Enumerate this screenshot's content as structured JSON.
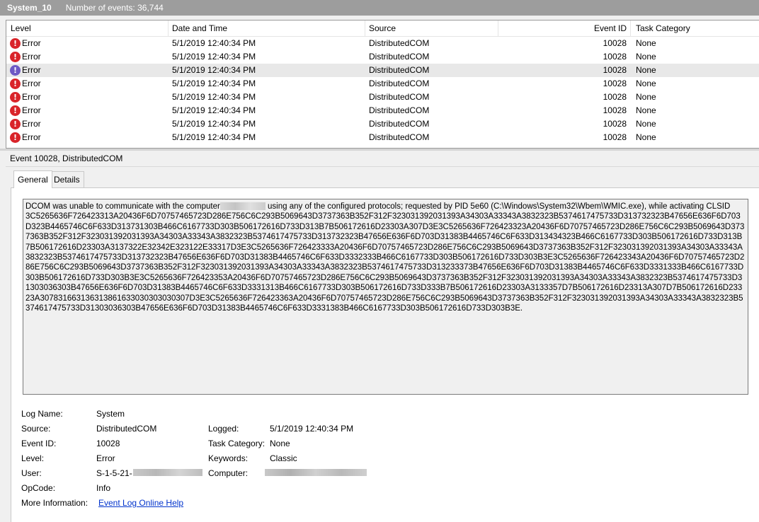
{
  "log": {
    "name": "System_10",
    "event_count": "Number of events: 36,744"
  },
  "grid": {
    "columns": [
      "Level",
      "Date and Time",
      "Source",
      "Event ID",
      "Task Category"
    ],
    "rows": [
      {
        "level": "Error",
        "date": "5/1/2019 12:40:34 PM",
        "source": "DistributedCOM",
        "id": "10028",
        "category": "None"
      },
      {
        "level": "Error",
        "date": "5/1/2019 12:40:34 PM",
        "source": "DistributedCOM",
        "id": "10028",
        "category": "None"
      },
      {
        "level": "Error",
        "date": "5/1/2019 12:40:34 PM",
        "source": "DistributedCOM",
        "id": "10028",
        "category": "None"
      },
      {
        "level": "Error",
        "date": "5/1/2019 12:40:34 PM",
        "source": "DistributedCOM",
        "id": "10028",
        "category": "None"
      },
      {
        "level": "Error",
        "date": "5/1/2019 12:40:34 PM",
        "source": "DistributedCOM",
        "id": "10028",
        "category": "None"
      },
      {
        "level": "Error",
        "date": "5/1/2019 12:40:34 PM",
        "source": "DistributedCOM",
        "id": "10028",
        "category": "None"
      },
      {
        "level": "Error",
        "date": "5/1/2019 12:40:34 PM",
        "source": "DistributedCOM",
        "id": "10028",
        "category": "None"
      },
      {
        "level": "Error",
        "date": "5/1/2019 12:40:34 PM",
        "source": "DistributedCOM",
        "id": "10028",
        "category": "None"
      }
    ],
    "icon": "error-icon"
  },
  "detail": {
    "title": "Event 10028, DistributedCOM",
    "tabs": {
      "general": "General",
      "details": "Details"
    },
    "message": {
      "part1": "DCOM was unable to communicate with the computer",
      "part2": " using any of the configured protocols; requested by PID     5e60 (C:\\Windows\\System32\\Wbem\\WMIC.exe), while activating CLSID",
      "clsid": "3C5265636F726423313A20436F6D70757465723D286E756C6C293B5069643D3737363B352F312F323031392031393A34303A33343A3832323B5374617475733D313732323B47656E636F6D703D323B4465746C6F633D313731303B466C6167733D303B506172616D733D313B7B506172616D23303A307D3E3C5265636F726423323A20436F6D70757465723D286E756C6C293B5069643D3737363B352F312F323031392031393A34303A33343A3832323B5374617475733D313732323B47656E636F6D703D31383B4465746C6F633D313434323B466C6167733D303B506172616D733D313B7B506172616D23303A3137322E32342E323122E33317D3E3C5265636F726423333A20436F6D70757465723D286E756C6C293B5069643D3737363B352F312F323031392031393A34303A33343A3832323B5374617475733D313732323B47656E636F6D703D31383B4465746C6F633D3332333B466C6167733D303B506172616D733D303B3E3C5265636F726423343A20436F6D70757465723D286E756C6C293B5069643D3737363B352F312F323031392031393A34303A33343A3832323B5374617475733D313233373B47656E636F6D703D31383B4465746C6F633D3331333B466C6167733D303B506172616D733D303B3E3C5265636F726423353A20436F6D70757465723D286E756C6C293B5069643D3737363B352F312F323031392031393A34303A33343A3832323B5374617475733D31303036303B47656E636F6D703D31383B4465746C6F633D3331313B466C6167733D303B506172616D733D333B7B506172616D23303A3133357D7B506172616D23313A307D7B506172616D23323A307831663136313861633030303030307D3E3C5265636F726423363A20436F6D70757465723D286E756C6C293B5069643D3737363B352F312F323031392031393A34303A33343A3832323B5374617475733D31303036303B47656E636F6D703D31383B4465746C6F633D3331383B466C6167733D303B506172616D733D303B3E."
    },
    "fields": {
      "log_name_label": "Log Name:",
      "log_name": "System",
      "source_label": "Source:",
      "source": "DistributedCOM",
      "logged_label": "Logged:",
      "logged": "5/1/2019 12:40:34 PM",
      "event_id_label": "Event ID:",
      "event_id": "10028",
      "task_category_label": "Task Category:",
      "task_category": "None",
      "level_label": "Level:",
      "level": "Error",
      "keywords_label": "Keywords:",
      "keywords": "Classic",
      "user_label": "User:",
      "user": "S-1-5-21-",
      "computer_label": "Computer:",
      "opcode_label": "OpCode:",
      "opcode": "Info",
      "more_info_label": "More Information:",
      "more_info_link": "Event Log Online Help"
    }
  }
}
